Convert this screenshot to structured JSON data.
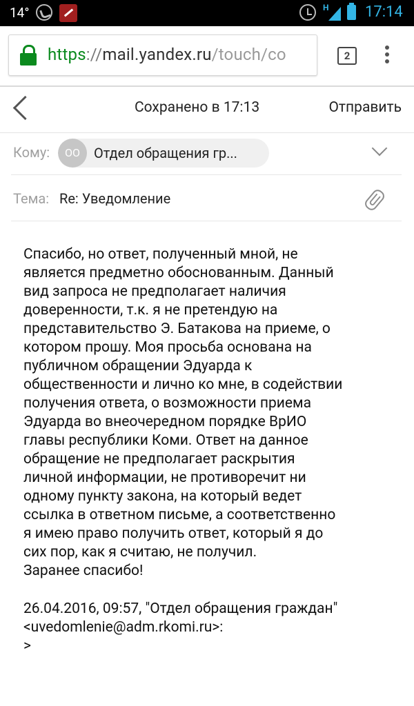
{
  "statusbar": {
    "temperature": "14°",
    "network": "H",
    "time": "17:14"
  },
  "browser": {
    "url_scheme": "https",
    "url_separator": "://",
    "url_host": "mail.yandex.ru",
    "url_path": "/touch/co",
    "tab_count": "2"
  },
  "toolbar": {
    "status": "Сохранено в 17:13",
    "send_label": "Отправить"
  },
  "compose": {
    "to_label": "Кому:",
    "recipient_initials": "ОО",
    "recipient_name": "Отдел обращения гр...",
    "subject_label": "Тема:",
    "subject_value": "Re: Уведомление",
    "body": "Спасибо, но ответ, полученный мной, не\nявляется предметно обоснованным. Данный\nвид запроса не предполагает наличия\nдоверенности, т.к. я не претендую на\nпредставительство Э. Батакова на приеме, о\nкотором прошу. Моя просьба основана на\nпубличном обращении Эдуарда к\nобщественности и лично ко мне, в содействии\nполучения ответа, о возможности приема\nЭдуарда во внеочередном порядке ВрИО\nглавы республики Коми. Ответ на данное\nобращение не предполагает раскрытия\nличной информации, не противоречит ни\nодному пункту закона, на который ведет\nссылка в ответном письме, а соответственно\nя имею право получить ответ, который я до\nсих пор, как я считаю, не получил.\nЗаранее спасибо!",
    "quote_header": "26.04.2016, 09:57, \"Отдел обращения граждан\"",
    "quote_email": "<uvedomlenie@adm.rkomi.ru>:",
    "quote_marker": ">"
  }
}
